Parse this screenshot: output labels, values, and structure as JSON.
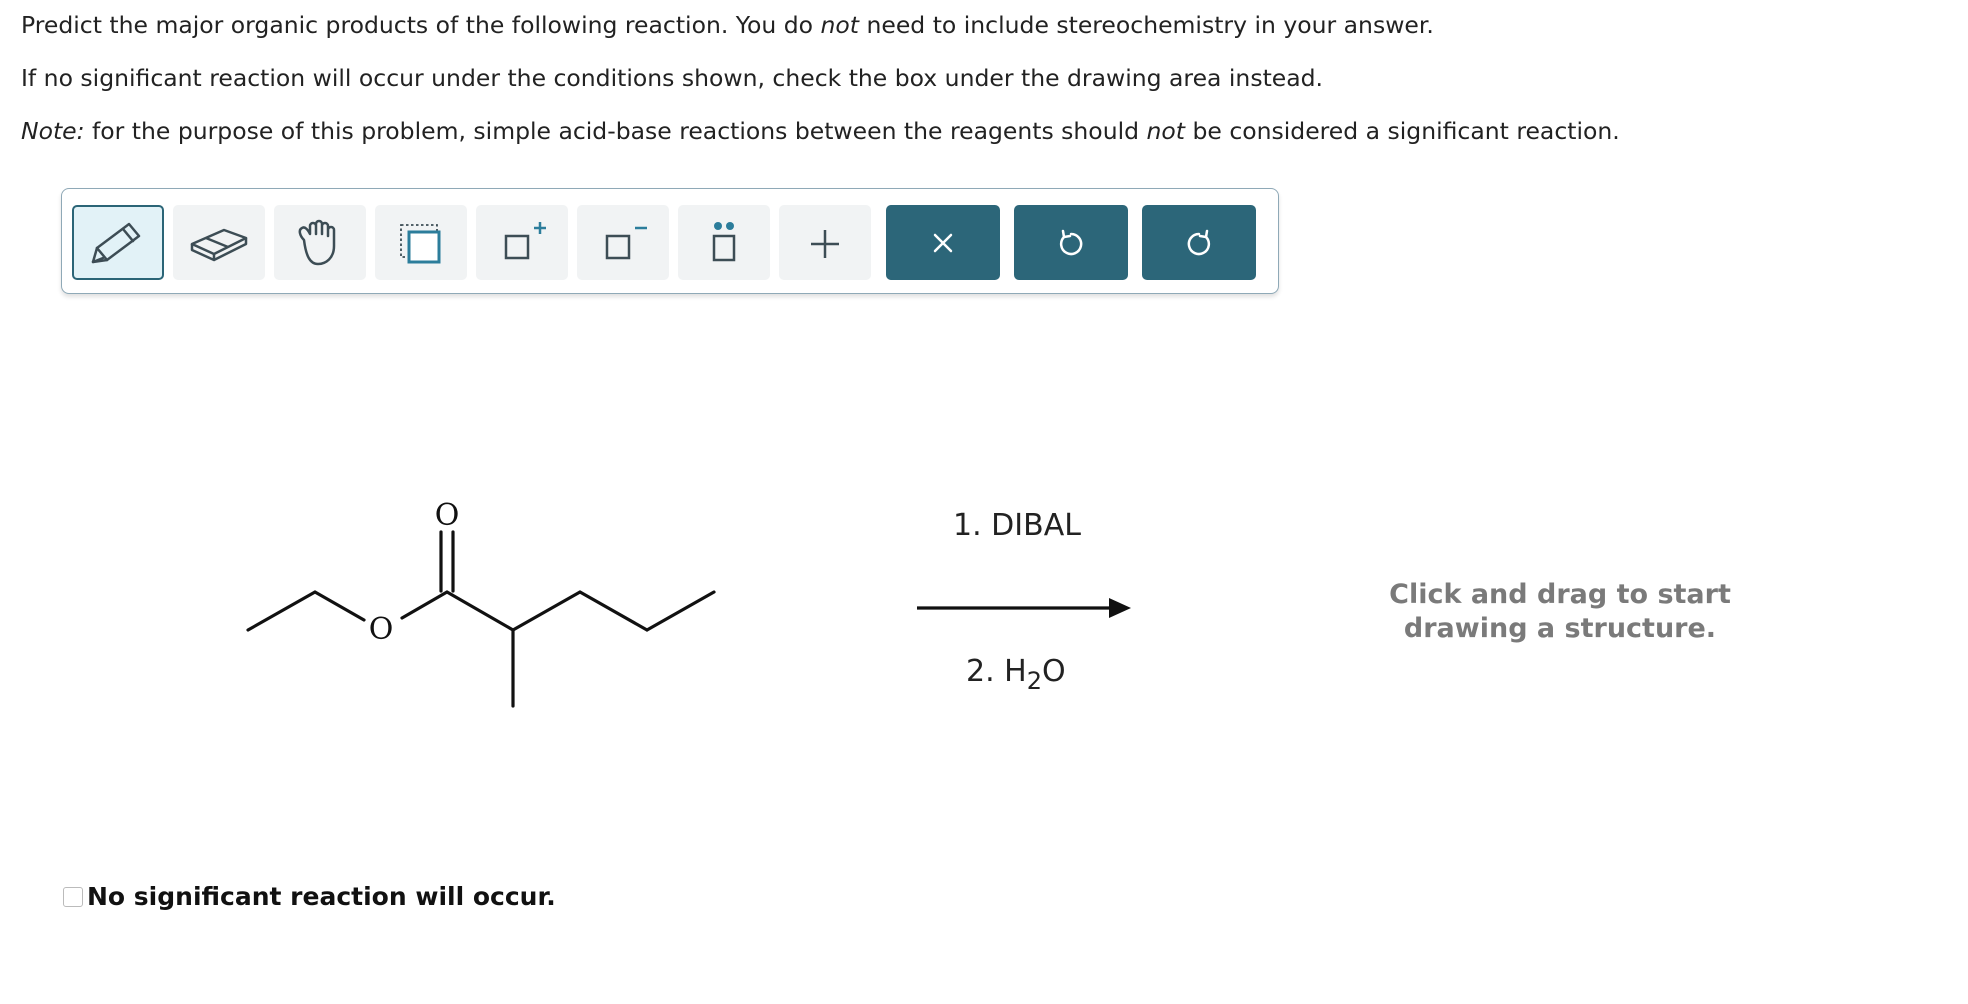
{
  "instructions": {
    "line1_pre": "Predict the major organic products of the following reaction. You do ",
    "line1_em": "not",
    "line1_post": " need to include stereochemistry in your answer.",
    "line2": "If no significant reaction will occur under the conditions shown, check the box under the drawing area instead.",
    "line3_note": "Note:",
    "line3_pre": " for the purpose of this problem, simple acid-base reactions between the reagents should ",
    "line3_em": "not",
    "line3_post": " be considered a significant reaction."
  },
  "toolbar": {
    "tools": [
      {
        "icon": "pencil-icon",
        "selected": true
      },
      {
        "icon": "eraser-icon"
      },
      {
        "icon": "hand-icon"
      },
      {
        "icon": "select-box-icon"
      },
      {
        "icon": "positive-charge-icon",
        "symbol": "+"
      },
      {
        "icon": "negative-charge-icon",
        "symbol": "−"
      },
      {
        "icon": "lone-pair-icon"
      },
      {
        "icon": "add-icon",
        "symbol": "+"
      },
      {
        "icon": "close-icon"
      },
      {
        "icon": "undo-icon"
      },
      {
        "icon": "redo-icon"
      }
    ],
    "accent": "#2c6679",
    "selected_bg": "#e2f2f7"
  },
  "reaction": {
    "reactant_atoms": {
      "carbonyl_o": "O",
      "ester_o": "O"
    },
    "condition_1_num": "1.",
    "condition_1_reagent": "DIBAL",
    "condition_2_num": "2.",
    "condition_2_reagent_main": "H",
    "condition_2_reagent_sub": "2",
    "condition_2_reagent_end": "O"
  },
  "drawing_prompt": {
    "line1": "Click and drag to start",
    "line2": "drawing a structure."
  },
  "no_reaction": {
    "label": "No significant reaction will occur.",
    "checked": false
  }
}
